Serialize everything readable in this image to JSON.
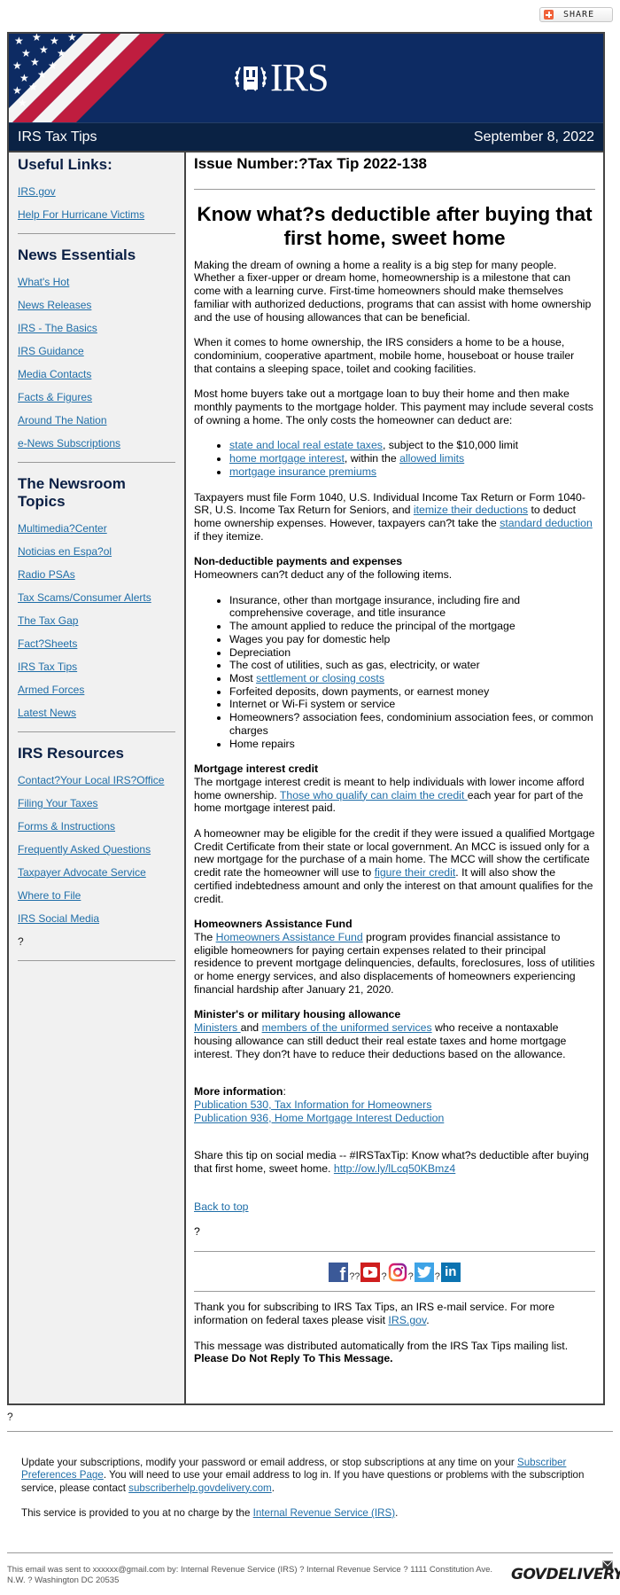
{
  "share": {
    "label": "SHARE"
  },
  "banner": {
    "logo_text": "IRS"
  },
  "titlebar": {
    "title": "IRS Tax Tips",
    "date": "September 8, 2022"
  },
  "sidebar": {
    "sections": [
      {
        "heading": "Useful Links:",
        "links": [
          "IRS.gov",
          "Help For Hurricane Victims"
        ]
      },
      {
        "heading": "News Essentials",
        "links": [
          "What's Hot",
          "News Releases",
          "IRS - The Basics",
          "IRS Guidance",
          "Media Contacts",
          "Facts & Figures",
          "Around The Nation",
          "e-News Subscriptions"
        ]
      },
      {
        "heading": "The Newsroom Topics",
        "links": [
          "Multimedia?Center",
          "Noticias en Espa?ol",
          "Radio PSAs",
          "Tax Scams/Consumer Alerts",
          "The Tax Gap",
          "Fact?Sheets",
          "IRS Tax Tips",
          "Armed Forces",
          "Latest News"
        ]
      },
      {
        "heading": "IRS Resources",
        "links": [
          "Contact?Your Local IRS?Office",
          "Filing Your Taxes",
          "Forms & Instructions",
          "Frequently Asked Questions",
          "Taxpayer Advocate Service",
          "Where to File",
          "IRS Social Media"
        ],
        "trailing": "?"
      }
    ]
  },
  "article": {
    "issue": "Issue Number:?Tax Tip 2022-138",
    "headline": "Know what?s deductible after buying that first home, sweet home",
    "p1": "Making the dream of owning a home a reality is a big step for many people. Whether a fixer-upper or dream home, homeownership is a milestone that can come with a learning curve. First-time homeowners should make themselves familiar with authorized deductions, programs that can assist with home ownership and the use of housing allowances that can be beneficial.",
    "p2": "When it comes to home ownership, the IRS considers a home to be a house, condominium, cooperative apartment, mobile home, houseboat or house trailer that contains a sleeping space, toilet and cooking facilities.",
    "p3": "Most home buyers take out a mortgage loan to buy their home and then make monthly payments to the mortgage holder. This payment may include several costs of owning a home. The only costs the homeowner can deduct are:",
    "deductible": {
      "item1_link": "state and local real estate taxes",
      "item1_rest": ", subject to the $10,000 limit",
      "item2_link": "home mortgage interest",
      "item2_mid": ", within the ",
      "item2_link2": "allowed limits",
      "item3_link": "mortgage insurance premiums"
    },
    "p4": {
      "t1": "Taxpayers must file Form 1040, U.S. Individual Income Tax Return or Form 1040-SR, U.S. Income Tax Return for Seniors, and ",
      "link1": "itemize their deductions",
      "t2": " to deduct home ownership expenses. However, taxpayers can?t take the ",
      "link2": "standard deduction",
      "t3": " if they itemize."
    },
    "nondeductible": {
      "heading": "Non-deductible payments and expenses",
      "intro": "Homeowners can?t deduct any of the following items.",
      "items": [
        "Insurance, other than mortgage insurance, including fire and comprehensive coverage, and title insurance",
        "The amount applied to reduce the principal of the mortgage",
        "Wages you pay for domestic help",
        "Depreciation",
        "The cost of utilities, such as gas, electricity, or water"
      ],
      "most_prefix": "Most ",
      "most_link": "settlement or closing costs",
      "items2": [
        "Forfeited deposits, down payments, or earnest money",
        "Internet or Wi-Fi system or service",
        "Homeowners? association fees, condominium association fees, or common charges",
        "Home repairs"
      ]
    },
    "mic": {
      "heading": "Mortgage interest credit",
      "t1": "The mortgage interest credit is meant to help individuals with lower income afford home ownership. ",
      "link1": "Those who qualify can claim the credit ",
      "t2": "each year for part of the home mortgage interest paid.",
      "p2_t1": "A homeowner may be eligible for the credit if they were issued a qualified Mortgage Credit Certificate from their state or local government. An MCC is issued only for a new mortgage for the purchase of a main home. The MCC will show the certificate credit rate the homeowner will use to ",
      "p2_link": "figure their credit",
      "p2_t2": ". It will also show the certified indebtedness amount and only the interest on that amount qualifies for the credit."
    },
    "haf": {
      "heading": "Homeowners Assistance Fund",
      "t1": "The ",
      "link": "Homeowners Assistance Fund",
      "t2": " program provides financial assistance to eligible homeowners for paying certain expenses related to their principal residence to prevent mortgage delinquencies, defaults, foreclosures, loss of utilities or home energy services, and also displacements of homeowners experiencing financial hardship after January 21, 2020."
    },
    "minister": {
      "heading": "Minister's or military housing allowance",
      "link1": "Ministers ",
      "t1": "and ",
      "link2": "members of the uniformed services",
      "t2": " who receive a nontaxable housing allowance can still deduct their real estate taxes and home mortgage interest. They don?t have to reduce their deductions based on the allowance."
    },
    "more_info": {
      "heading": "More information",
      "colon": ":",
      "links": [
        "Publication 530, Tax Information for Homeowners",
        "Publication 936, Home Mortgage Interest Deduction"
      ]
    },
    "share_tip": {
      "text": "Share this tip on social media -- #IRSTaxTip: Know what?s deductible after buying that first home, sweet home. ",
      "link": "http://ow.ly/lLcq50KBmz4"
    },
    "back_to_top": "Back to top",
    "qmark": "?",
    "social": {
      "icons": [
        "facebook-icon",
        "youtube-icon",
        "instagram-icon",
        "twitter-icon",
        "linkedin-icon"
      ],
      "separators": [
        "??",
        "?",
        "?",
        "?"
      ]
    },
    "thanks": {
      "t1": "Thank you for subscribing to IRS Tax Tips, an IRS e-mail service. For more information on federal taxes please visit ",
      "link": "IRS.gov",
      "t2": "."
    },
    "distributed": {
      "t1": "This message was distributed automatically from the IRS Tax Tips mailing list. ",
      "bold": "Please Do Not Reply To This Message."
    }
  },
  "footer": {
    "qmark": "?",
    "update": {
      "t1": "Update your subscriptions, modify your password or email address, or stop subscriptions at any time on your ",
      "link1": "Subscriber Preferences Page",
      "t2": ". You will need to use your email address to log in. If you have questions or problems with the subscription service, please contact ",
      "link2": "subscriberhelp.govdelivery.com",
      "t3": "."
    },
    "service": {
      "t1": "This service is provided to you at no charge by the ",
      "link": "Internal Revenue Service (IRS)",
      "t2": "."
    },
    "sent_to": "This email was sent to xxxxxx@gmail.com by: Internal Revenue Service (IRS) ? Internal Revenue Service ? 1111 Constitution Ave. N.W. ? Washington DC 20535",
    "brand": "GOVDELIVERY"
  },
  "colors": {
    "banner_bg": "#0d2b63",
    "titlebar_bg": "#0a2244",
    "link": "#1f6ea8",
    "sidebar_bg": "#f1f1f1",
    "flag_red": "#bf1d3f"
  }
}
